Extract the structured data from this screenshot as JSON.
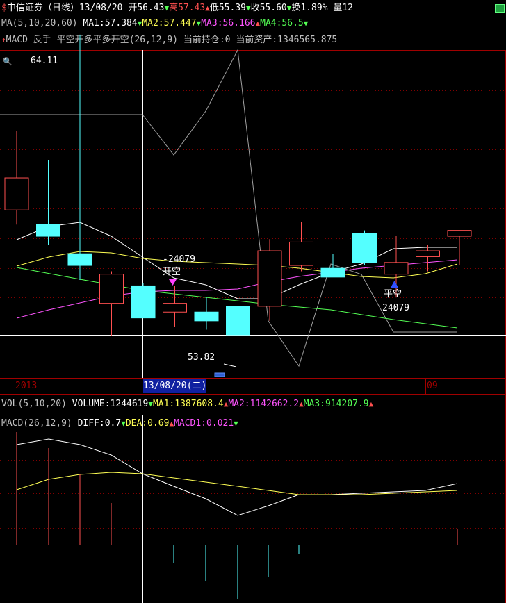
{
  "header": {
    "name": "中信证券",
    "period": "（日线）",
    "date": "13/08/20",
    "open": "开56.43",
    "high": "高57.43",
    "low": "低55.39",
    "close": "收55.60",
    "turnover": "换1.89%",
    "volume_cut": "量12"
  },
  "ma_line": {
    "label": "MA(5,10,20,60)",
    "ma1": "MA1:57.384",
    "ma2": "MA2:57.447",
    "ma3": "MA3:56.166",
    "ma4": "MA4:56.5"
  },
  "strategy_line": {
    "text": "MACD 反手 平空开多平多开空(26,12,9)",
    "position": "当前持仓:0",
    "assets": "当前资产:1346565.875"
  },
  "price_labels": {
    "high_mark": "64.11",
    "low_mark": "53.82",
    "open_short_value": "-24079",
    "open_short": "开空",
    "close_short": "平空",
    "close_short_value": "24079"
  },
  "time_axis": {
    "year": "2013",
    "cursor_date": "13/08/20(二)",
    "month": "09"
  },
  "vol_line": {
    "label": "VOL(5,10,20)",
    "volume": "VOLUME:1244619",
    "ma1": "MA1:1387608.4",
    "ma2": "MA2:1142662.2",
    "ma3": "MA3:914207.9"
  },
  "macd_line": {
    "label": "MACD(26,12,9)",
    "diff": "DIFF:0.7",
    "dea": "DEA:0.69",
    "macd1": "MACD1:0.021"
  },
  "colors": {
    "up": "#ff5050",
    "down": "#54ffff",
    "ma1": "#ffffff",
    "ma2": "#ffff54",
    "ma3": "#ff54ff",
    "ma4": "#54ff54",
    "frame": "#a00000"
  },
  "candles": [
    {
      "o": 58.1,
      "c": 59.2,
      "h": 60.8,
      "l": 57.6
    },
    {
      "o": 57.6,
      "c": 57.2,
      "h": 59.8,
      "l": 56.9
    },
    {
      "o": 56.6,
      "c": 56.2,
      "h": 64.11,
      "l": 55.7
    },
    {
      "o": 54.9,
      "c": 55.9,
      "h": 56.0,
      "l": 53.8
    },
    {
      "o": 55.5,
      "c": 54.4,
      "h": 55.6,
      "l": 54.4
    },
    {
      "o": 54.6,
      "c": 54.9,
      "h": 55.5,
      "l": 54.1
    },
    {
      "o": 54.6,
      "c": 54.3,
      "h": 55.1,
      "l": 54.0
    },
    {
      "o": 54.8,
      "c": 53.82,
      "h": 55.1,
      "l": 53.82
    },
    {
      "o": 54.8,
      "c": 56.7,
      "h": 57.1,
      "l": 54.3
    },
    {
      "o": 56.2,
      "c": 57.0,
      "h": 57.7,
      "l": 56.0
    },
    {
      "o": 56.1,
      "c": 55.8,
      "h": 56.6,
      "l": 55.8
    },
    {
      "o": 57.3,
      "c": 56.3,
      "h": 57.4,
      "l": 56.2
    },
    {
      "o": 55.9,
      "c": 56.3,
      "h": 57.2,
      "l": 55.1
    },
    {
      "o": 56.5,
      "c": 56.7,
      "h": 56.9,
      "l": 56.0
    },
    {
      "o": 57.2,
      "c": 57.4,
      "h": 57.4,
      "l": 56.2
    }
  ]
}
